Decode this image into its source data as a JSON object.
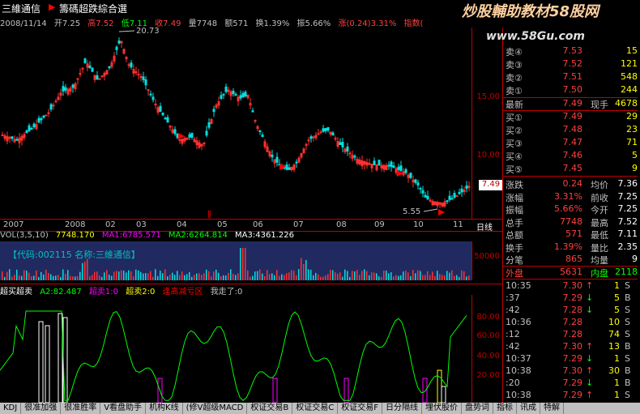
{
  "header": {
    "stock_name": "三維通信",
    "selector": "籌碼超跌綜合選",
    "watermark": "炒股輔助教材58股网",
    "url": "www.58Gu.com"
  },
  "info_bar": {
    "date": "2008/11/14",
    "open": "开7.25",
    "high": "高7.52",
    "low": "低7.11",
    "close": "收7.49",
    "volume": "量7748",
    "amount": "额571",
    "turnover": "换1.39%",
    "amplitude": "振5.66%",
    "change": "涨(0.24)3.31%",
    "index_label": "指数("
  },
  "main_chart": {
    "y_ticks": [
      "15.00",
      "10.00"
    ],
    "peak_label": "20.73",
    "low_label": "5.55",
    "current_price_tag": "7.49"
  },
  "date_axis": [
    "2007",
    "2008",
    "02",
    "03",
    "04",
    "05",
    "06",
    "07",
    "08",
    "09",
    "10",
    "11"
  ],
  "period_label": "日线",
  "volume_bar": {
    "title": "VOL(3,5,10)",
    "vol": "7748.170",
    "ma1": "MA1:6785.571",
    "ma2": "MA2:6264.814",
    "ma3": "MA3:4361.226",
    "banner": "【代码:002115 名称:三維通信】",
    "y_tick": "50000"
  },
  "oscillator": {
    "title": "超买超卖",
    "a2": "A2:82.487",
    "sig1": "超卖1:0",
    "sig2": "超卖2:0",
    "sig3": "逢高减亏区",
    "sig4": "我走了:0",
    "y_ticks": [
      "80.00",
      "60.00",
      "40.00",
      "20.00"
    ]
  },
  "quote_panel": {
    "ask": [
      {
        "label": "卖④",
        "price": "7.53",
        "vol": "15"
      },
      {
        "label": "卖③",
        "price": "7.52",
        "vol": "121"
      },
      {
        "label": "卖②",
        "price": "7.51",
        "vol": "548"
      },
      {
        "label": "卖①",
        "price": "7.50",
        "vol": "244"
      }
    ],
    "latest": {
      "label": "最新",
      "price": "7.49",
      "label2": "现手",
      "vol": "4678"
    },
    "bid": [
      {
        "label": "买①",
        "price": "7.49",
        "vol": "29"
      },
      {
        "label": "买②",
        "price": "7.48",
        "vol": "23"
      },
      {
        "label": "买③",
        "price": "7.47",
        "vol": "71"
      },
      {
        "label": "买④",
        "price": "7.46",
        "vol": "5"
      },
      {
        "label": "买⑤",
        "price": "7.45",
        "vol": "9"
      }
    ],
    "stats": [
      {
        "l1": "涨跌",
        "v1": "0.24",
        "l2": "均价",
        "v2": "7.36"
      },
      {
        "l1": "涨幅",
        "v1": "3.31%",
        "l2": "前收",
        "v2": "7.25"
      },
      {
        "l1": "振幅",
        "v1": "5.66%",
        "l2": "今开",
        "v2": "7.25"
      },
      {
        "l1": "总手",
        "v1": "7748",
        "l2": "最高",
        "v2": "7.52"
      },
      {
        "l1": "总额",
        "v1": "571",
        "l2": "最低",
        "v2": "7.11"
      },
      {
        "l1": "换手",
        "v1": "1.39%",
        "l2": "量比",
        "v2": "2.35"
      },
      {
        "l1": "分笔",
        "v1": "865",
        "l2": "均量",
        "v2": "9"
      }
    ],
    "outer": {
      "l1": "外盘",
      "v1": "5631",
      "l2": "内盘",
      "v2": "2118"
    },
    "ticks": [
      {
        "t": "10:35",
        "p": "7.30",
        "d": "↑",
        "v": "1",
        "s": "S"
      },
      {
        "t": ":37",
        "p": "7.29",
        "d": "↓",
        "v": "5",
        "s": "B"
      },
      {
        "t": ":42",
        "p": "7.28",
        "d": "↓",
        "v": "5",
        "s": "S"
      },
      {
        "t": "10:36",
        "p": "7.28",
        "d": "",
        "v": "10",
        "s": "S"
      },
      {
        "t": ":12",
        "p": "7.28",
        "d": "",
        "v": "74",
        "s": "S"
      },
      {
        "t": ":42",
        "p": "7.30",
        "d": "↑",
        "v": "13",
        "s": "B"
      },
      {
        "t": "10:37",
        "p": "7.29",
        "d": "↓",
        "v": "1",
        "s": "S"
      },
      {
        "t": "10:38",
        "p": "7.30",
        "d": "↑",
        "v": "30",
        "s": "B"
      },
      {
        "t": ":20",
        "p": "7.29",
        "d": "↓",
        "v": "1",
        "s": "B"
      },
      {
        "t": "10:38",
        "p": "7.29",
        "d": "↑",
        "v": "1",
        "s": "S"
      }
    ]
  },
  "bottom_tabs": [
    "KDJ",
    "很准加强",
    "很准胜率",
    "V看盘助手",
    "机构K线",
    "(修V超级MACD",
    "权证交易B",
    "权证交易C",
    "权证交易F",
    "日分隔线",
    "埋伏股价",
    "盘势词",
    "指标",
    "讯成",
    "特解"
  ]
}
